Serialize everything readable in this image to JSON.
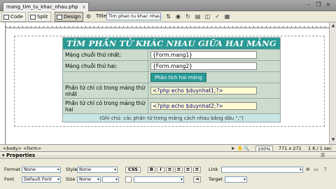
{
  "window": {
    "file_tab": "mang_tim_tu_khac_nhau.php",
    "tab_close": "x"
  },
  "toolbar": {
    "code_label": "Code",
    "split_label": "Split",
    "design_label": "Design",
    "title_label": "Title:",
    "title_value": "Tim phan tu khac nhau"
  },
  "form": {
    "heading": "TÌM PHẦN TỬ KHÁC NHAU GIỮA HAI MẢNG",
    "rows": [
      {
        "label": "Mảng chuỗi thứ nhất:",
        "value": "{Form.mang1}"
      },
      {
        "label": "Mảng chuỗi thứ hai:",
        "value": "{Form.mang2}"
      }
    ],
    "button_label": "Phân tích hai mảng",
    "result1_label": "Phần tử chỉ có trong mảng thứ nhất",
    "result1_value": "<?php echo $duynhat1;?>",
    "result2_label": "Phần tử chỉ có trong mảng thứ hai",
    "result2_value": "<?php echo $duynhat2;?>",
    "note": "(Ghi chú: các phần tử trong mảng cách nhau bằng dấu \",\")"
  },
  "statusbar": {
    "tags": "<body> <form>",
    "zoom": "100%",
    "dimensions": "771 x 271",
    "download": "1 K / 1 sec"
  },
  "properties": {
    "title": "Properties",
    "format_label": "Format",
    "format_value": "None",
    "style_label": "Style",
    "style_value": "None",
    "css_label": "CSS",
    "bold": "B",
    "italic": "I",
    "link_label": "Link",
    "font_label": "Font",
    "font_value": "Default Font",
    "size_label": "Size",
    "size_value": "None",
    "target_label": "Target"
  },
  "colors": {
    "accent": "#2a9a95",
    "table_bg": "#ccdccc",
    "php_field": "#fffbd0"
  }
}
